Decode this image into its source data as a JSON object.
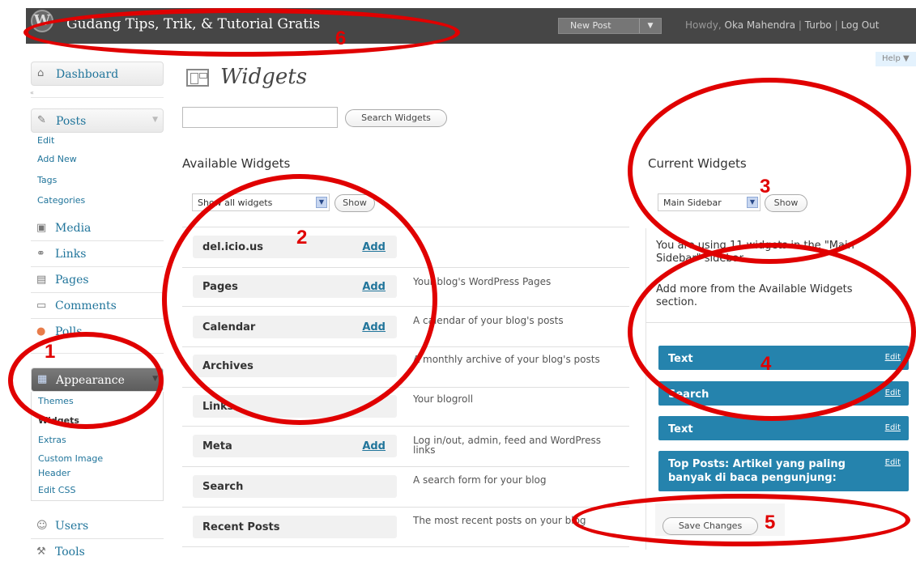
{
  "header": {
    "site_title": "Gudang Tips, Trik, & Tutorial Gratis",
    "new_post_label": "New Post",
    "howdy_prefix": "Howdy, ",
    "user_name": "Oka Mahendra",
    "turbo": "Turbo",
    "log_out": "Log Out",
    "sep1": " | ",
    "sep2": " | "
  },
  "help_label": "Help",
  "sidebar": {
    "dashboard": "Dashboard",
    "posts": "Posts",
    "posts_sub": [
      "Edit",
      "Add New",
      "Tags",
      "Categories"
    ],
    "media": "Media",
    "links": "Links",
    "pages": "Pages",
    "comments": "Comments",
    "polls": "Polls",
    "appearance": "Appearance",
    "appearance_sub": [
      "Themes",
      "Widgets",
      "Extras",
      "Custom Image Header",
      "Edit CSS"
    ],
    "users": "Users",
    "tools": "Tools"
  },
  "page": {
    "title": "Widgets",
    "search_button": "Search Widgets",
    "available_heading": "Available Widgets",
    "filter_value": "Show all widgets",
    "show_button": "Show",
    "current_heading": "Current Widgets",
    "sidebar_select_value": "Main Sidebar",
    "current_show_button": "Show",
    "using_text": "You are using 11 widgets in the \"Main Sidebar\" sidebar.",
    "add_more_text": "Add more from the Available Widgets section.",
    "save_button": "Save Changes"
  },
  "available_widgets": [
    {
      "name": "del.icio.us",
      "add": "Add",
      "desc": ""
    },
    {
      "name": "Pages",
      "add": "Add",
      "desc": "Your blog's WordPress Pages"
    },
    {
      "name": "Calendar",
      "add": "Add",
      "desc": "A calendar of your blog's posts"
    },
    {
      "name": "Archives",
      "add": "",
      "desc": "A monthly archive of your blog's posts"
    },
    {
      "name": "Links",
      "add": "",
      "desc": "Your blogroll"
    },
    {
      "name": "Meta",
      "add": "Add",
      "desc": "Log in/out, admin, feed and WordPress links"
    },
    {
      "name": "Search",
      "add": "",
      "desc": "A search form for your blog"
    },
    {
      "name": "Recent Posts",
      "add": "",
      "desc": "The most recent posts on your blog"
    }
  ],
  "current_widgets": [
    {
      "name": "Text",
      "edit": "Edit"
    },
    {
      "name": "Search",
      "edit": "Edit"
    },
    {
      "name": "Text",
      "edit": "Edit"
    },
    {
      "name": "Top Posts: Artikel yang paling banyak di baca pengunjung:",
      "edit": "Edit"
    }
  ],
  "annotations": [
    "1",
    "2",
    "3",
    "4",
    "5",
    "6"
  ],
  "colors": {
    "accent": "#21759b",
    "header": "#464646",
    "widget_bar": "#2583ad",
    "annotation": "#e00000"
  }
}
